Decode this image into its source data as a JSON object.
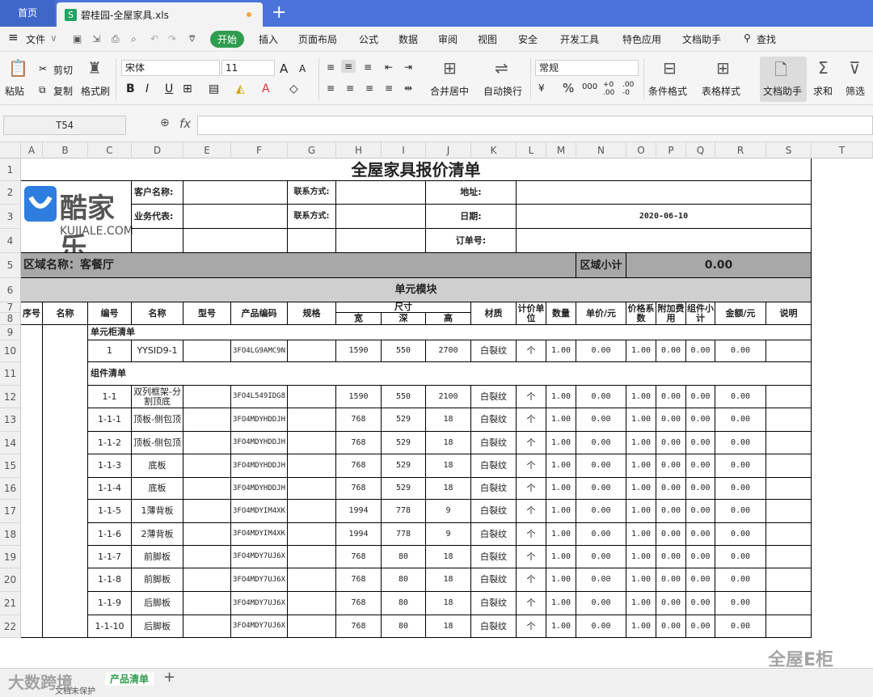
{
  "tabs": {
    "home": "首页",
    "file": "碧桂园-全屋家具.xls",
    "file_icon": "S",
    "new_tab": "+"
  },
  "menu": {
    "file": "文件",
    "items": [
      "开始",
      "插入",
      "页面布局",
      "公式",
      "数据",
      "审阅",
      "视图",
      "安全",
      "开发工具",
      "特色应用",
      "文档助手"
    ],
    "search": "查找"
  },
  "ribbon": {
    "paste": "粘贴",
    "cut": "剪切",
    "copy": "复制",
    "format_painter": "格式刷",
    "font": "宋体",
    "font_size": "11",
    "bold": "B",
    "italic": "I",
    "underline": "U",
    "merge": "合并居中",
    "wrap": "自动换行",
    "number_format": "常规",
    "percent": "%",
    "thousands": "000",
    "cond_format": "条件格式",
    "table_style": "表格样式",
    "doc_helper": "文档助手",
    "sum": "求和",
    "filter": "筛选",
    "inc_font": "A",
    "dec_font": "A"
  },
  "formula": {
    "cell_ref": "T54",
    "fx": "fx"
  },
  "columns": [
    "A",
    "B",
    "C",
    "D",
    "E",
    "F",
    "G",
    "H",
    "I",
    "J",
    "K",
    "L",
    "M",
    "N",
    "O",
    "P",
    "Q",
    "R",
    "S",
    "T"
  ],
  "rows": [
    "1",
    "2",
    "3",
    "4",
    "5",
    "6",
    "7",
    "8",
    "9",
    "10",
    "11",
    "12",
    "13",
    "14",
    "15",
    "16",
    "17",
    "18",
    "19",
    "20",
    "21",
    "22"
  ],
  "sheet": {
    "title": "全屋家具报价清单",
    "logo_text": "酷家乐",
    "logo_sub": "KUJIALE.COM",
    "customer_label": "客户名称:",
    "contact_label": "联系方式:",
    "address_label": "地址:",
    "rep_label": "业务代表:",
    "contact_label2": "联系方式:",
    "date_label": "日期:",
    "date_value": "2020-06-10",
    "order_label": "订单号:",
    "area_label": "区域名称：客餐厅",
    "area_subtotal_label": "区域小计",
    "area_subtotal": "0.00",
    "unit_module": "单元模块",
    "headers": {
      "seq": "序号",
      "name": "名称",
      "code": "编号",
      "name2": "名称",
      "model": "型号",
      "product_code": "产品编码",
      "spec": "规格",
      "size": "尺寸",
      "width": "宽",
      "depth": "深",
      "height": "高",
      "material": "材质",
      "price_unit": "计价单位",
      "qty": "数量",
      "unit_price": "单价/元",
      "price_coef": "价格系数",
      "extra_fee": "附加费用",
      "group_subtotal": "组件小计",
      "amount": "金额/元",
      "note": "说明"
    },
    "section_cabinet": "单元柜清单",
    "section_component": "组件清单",
    "cabinet_row": {
      "code": "1",
      "name": "YYSID9-1",
      "product_code": "3FO4LG9AMC9N",
      "w": "1590",
      "d": "550",
      "h": "2700",
      "material": "白裂纹",
      "unit": "个",
      "qty": "1.00",
      "price": "0.00",
      "coef": "1.00",
      "fee": "0.00",
      "sub": "0.00",
      "amount": "0.00"
    },
    "component_rows": [
      {
        "code": "1-1",
        "name": "双列框架-分割顶底",
        "product_code": "3FO4L549IDG8",
        "w": "1590",
        "d": "550",
        "h": "2100"
      },
      {
        "code": "1-1-1",
        "name": "顶板-侧包顶",
        "product_code": "3FO4MDYHDDJH",
        "w": "768",
        "d": "529",
        "h": "18"
      },
      {
        "code": "1-1-2",
        "name": "顶板-侧包顶",
        "product_code": "3FO4MDYHDDJH",
        "w": "768",
        "d": "529",
        "h": "18"
      },
      {
        "code": "1-1-3",
        "name": "底板",
        "product_code": "3FO4MDYHDDJH",
        "w": "768",
        "d": "529",
        "h": "18"
      },
      {
        "code": "1-1-4",
        "name": "底板",
        "product_code": "3FO4MDYHDDJH",
        "w": "768",
        "d": "529",
        "h": "18"
      },
      {
        "code": "1-1-5",
        "name": "1薄背板",
        "product_code": "3FO4MDYIM4XK",
        "w": "1994",
        "d": "778",
        "h": "9"
      },
      {
        "code": "1-1-6",
        "name": "2薄背板",
        "product_code": "3FO4MDYIM4XK",
        "w": "1994",
        "d": "778",
        "h": "9"
      },
      {
        "code": "1-1-7",
        "name": "前脚板",
        "product_code": "3FO4MDY7UJ6X",
        "w": "768",
        "d": "80",
        "h": "18"
      },
      {
        "code": "1-1-8",
        "name": "前脚板",
        "product_code": "3FO4MDY7UJ6X",
        "w": "768",
        "d": "80",
        "h": "18"
      },
      {
        "code": "1-1-9",
        "name": "后脚板",
        "product_code": "3FO4MDY7UJ6X",
        "w": "768",
        "d": "80",
        "h": "18"
      },
      {
        "code": "1-1-10",
        "name": "后脚板",
        "product_code": "3FO4MDY7UJ6X",
        "w": "768",
        "d": "80",
        "h": "18"
      }
    ],
    "row_defaults": {
      "material": "白裂纹",
      "unit": "个",
      "qty": "1.00",
      "price": "0.00",
      "coef": "1.00",
      "fee": "0.00",
      "sub": "0.00",
      "amount": "0.00"
    }
  },
  "sheet_tab": "产品清单",
  "watermark_left": "大数跨境",
  "watermark_right": "全屋E柜",
  "status": "文档未保护"
}
